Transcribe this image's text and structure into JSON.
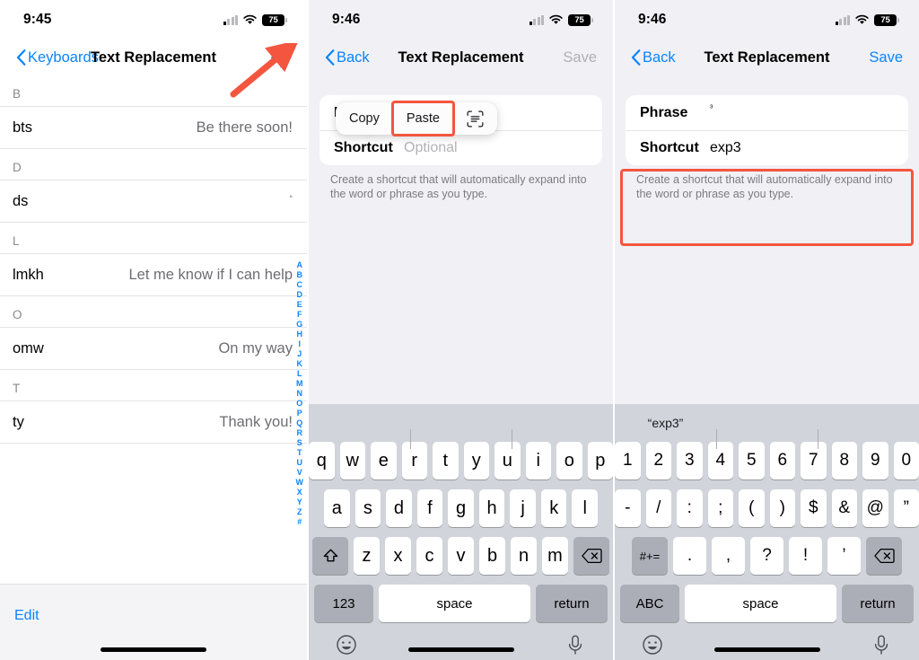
{
  "panel1": {
    "status": {
      "time": "9:45",
      "battery": "75",
      "wifi_icon": "wifi-icon",
      "cellular_icon": "cellular-signal-icon"
    },
    "nav": {
      "back_label": "Keyboards",
      "title": "Text Replacement",
      "add_icon": "plus-icon"
    },
    "sections": [
      {
        "letter": "B",
        "rows": [
          {
            "shortcut": "bts",
            "phrase": "Be there soon!",
            "tiny": false
          }
        ]
      },
      {
        "letter": "D",
        "rows": [
          {
            "shortcut": "ds",
            "phrase": "°",
            "tiny": true
          }
        ]
      },
      {
        "letter": "L",
        "rows": [
          {
            "shortcut": "lmkh",
            "phrase": "Let me know if I can help",
            "tiny": false
          }
        ]
      },
      {
        "letter": "O",
        "rows": [
          {
            "shortcut": "omw",
            "phrase": "On my way",
            "tiny": false
          }
        ]
      },
      {
        "letter": "T",
        "rows": [
          {
            "shortcut": "ty",
            "phrase": "Thank you!",
            "tiny": false
          }
        ]
      }
    ],
    "index": [
      "A",
      "B",
      "C",
      "D",
      "E",
      "F",
      "G",
      "H",
      "I",
      "J",
      "K",
      "L",
      "M",
      "N",
      "O",
      "P",
      "Q",
      "R",
      "S",
      "T",
      "U",
      "V",
      "W",
      "X",
      "Y",
      "Z",
      "#"
    ],
    "edit_label": "Edit",
    "annotation": {
      "arrow_color": "#f4553f",
      "points_to": "plus-icon"
    }
  },
  "panel2": {
    "status": {
      "time": "9:46",
      "battery": "75"
    },
    "nav": {
      "back_label": "Back",
      "title": "Text Replacement",
      "action_label": "Save",
      "action_disabled": true
    },
    "popup": {
      "items": [
        {
          "label": "Copy",
          "highlighted": false,
          "icon": null
        },
        {
          "label": "Paste",
          "highlighted": true,
          "icon": null
        },
        {
          "label": "",
          "highlighted": false,
          "icon": "scan-text-icon"
        }
      ],
      "highlight_color": "#f4553f"
    },
    "form": {
      "rows": [
        {
          "label": "Phrase",
          "value": "",
          "placeholder": "",
          "caret": true,
          "sup": false
        },
        {
          "label": "Shortcut",
          "value": "",
          "placeholder": "Optional",
          "caret": false,
          "sup": false
        }
      ],
      "hint": "Create a shortcut that will automatically expand into the word or phrase as you type."
    },
    "keyboard": {
      "type": "alphabetic",
      "predictions": [
        "",
        "",
        ""
      ],
      "row1": [
        "q",
        "w",
        "e",
        "r",
        "t",
        "y",
        "u",
        "i",
        "o",
        "p"
      ],
      "row2": [
        "a",
        "s",
        "d",
        "f",
        "g",
        "h",
        "j",
        "k",
        "l"
      ],
      "row3": [
        "z",
        "x",
        "c",
        "v",
        "b",
        "n",
        "m"
      ],
      "shift_icon": "shift-icon",
      "delete_icon": "delete-key-icon",
      "mode_key": "123",
      "space_key": "space",
      "return_key": "return",
      "emoji_icon": "emoji-icon",
      "mic_icon": "microphone-icon"
    }
  },
  "panel3": {
    "status": {
      "time": "9:46",
      "battery": "75"
    },
    "nav": {
      "back_label": "Back",
      "title": "Text Replacement",
      "action_label": "Save",
      "action_disabled": false
    },
    "form": {
      "rows": [
        {
          "label": "Phrase",
          "value": "³",
          "placeholder": "",
          "caret": false,
          "sup": true
        },
        {
          "label": "Shortcut",
          "value": "exp3",
          "placeholder": "",
          "caret": false,
          "sup": false
        }
      ],
      "hint": "Create a shortcut that will automatically expand into the word or phrase as you type.",
      "highlight_color": "#f4553f"
    },
    "keyboard": {
      "type": "numeric",
      "predictions": [
        "“exp3”",
        "",
        ""
      ],
      "row1": [
        "1",
        "2",
        "3",
        "4",
        "5",
        "6",
        "7",
        "8",
        "9",
        "0"
      ],
      "row2": [
        "-",
        "/",
        ":",
        ";",
        "(",
        ")",
        "$",
        "&",
        "@",
        "”"
      ],
      "row3": [
        ".",
        ",",
        "?",
        "!",
        "’"
      ],
      "alt_key": "#+=",
      "delete_icon": "delete-key-icon",
      "mode_key": "ABC",
      "space_key": "space",
      "return_key": "return",
      "emoji_icon": "emoji-icon",
      "mic_icon": "microphone-icon"
    }
  }
}
